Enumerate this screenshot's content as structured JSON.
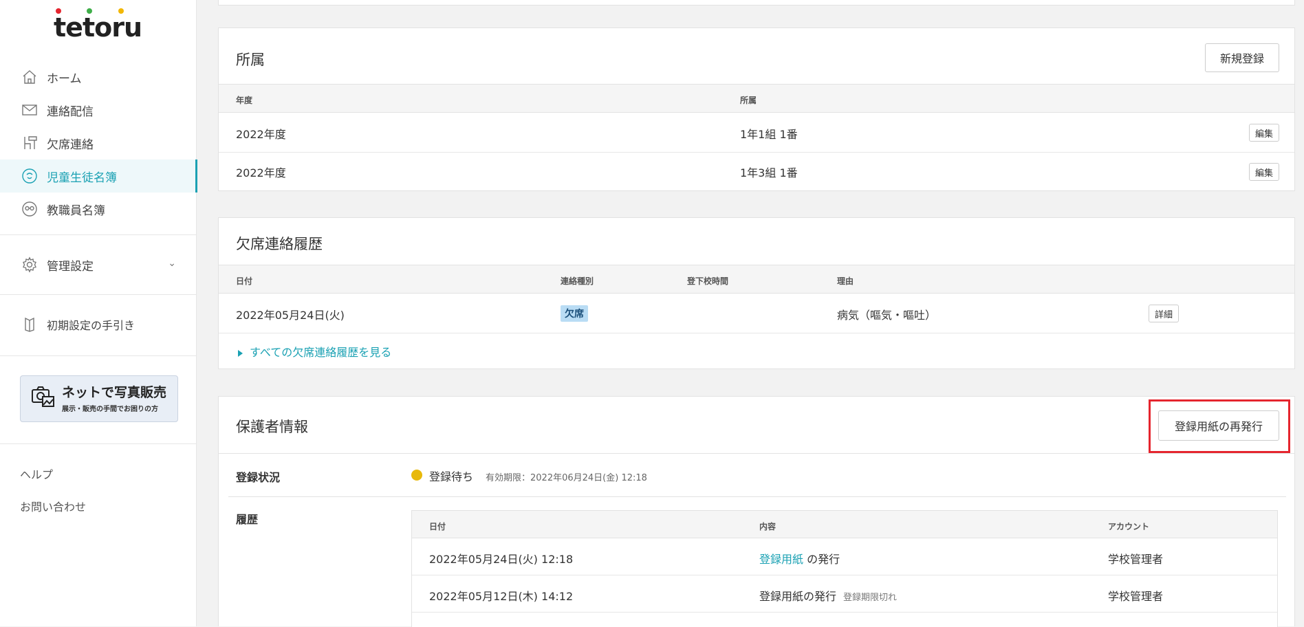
{
  "sidebar": {
    "logo_text": "tetoru",
    "logo_colors": [
      "#e5252e",
      "#3fae49",
      "#f2b705"
    ],
    "nav": [
      {
        "icon": "home-icon",
        "label": "ホーム"
      },
      {
        "icon": "mail-icon",
        "label": "連絡配信"
      },
      {
        "icon": "desk-chair-icon",
        "label": "欠席連絡"
      },
      {
        "icon": "student-icon",
        "label": "児童生徒名簿",
        "active": true
      },
      {
        "icon": "teacher-icon",
        "label": "教職員名簿"
      }
    ],
    "management": {
      "icon": "gear-icon",
      "label": "管理設定"
    },
    "guide": {
      "icon": "book-icon",
      "label": "初期設定の手引き"
    },
    "banner": {
      "icon": "camera-photo-icon",
      "main": "ネットで写真販売",
      "sub": "展示・販売の手間でお困りの方"
    },
    "help": "ヘルプ",
    "contact": "お問い合わせ"
  },
  "affiliation": {
    "title": "所属",
    "new_button": "新規登録",
    "headers": {
      "year": "年度",
      "affiliation": "所属"
    },
    "rows": [
      {
        "year": "2022年度",
        "affiliation": "1年1組 1番",
        "edit": "編集"
      },
      {
        "year": "2022年度",
        "affiliation": "1年3組 1番",
        "edit": "編集"
      }
    ]
  },
  "absence": {
    "title": "欠席連絡履歴",
    "headers": {
      "date": "日付",
      "type": "連絡種別",
      "time": "登下校時間",
      "reason": "理由"
    },
    "rows": [
      {
        "date": "2022年05月24日(火)",
        "type": "欠席",
        "time": "",
        "reason": "病気（嘔気・嘔吐）",
        "detail": "詳細"
      }
    ],
    "all_link": "すべての欠席連絡履歴を見る"
  },
  "guardian": {
    "title": "保護者情報",
    "reissue_button": "登録用紙の再発行",
    "status_label": "登録状況",
    "status_value": "登録待ち",
    "status_color": "#e8b90b",
    "expiry": "有効期限：2022年06月24日(金) 12:18",
    "history_label": "履歴",
    "history_headers": {
      "date": "日付",
      "content": "内容",
      "account": "アカウント"
    },
    "history": [
      {
        "date": "2022年05月24日(火) 12:18",
        "link": "登録用紙",
        "content": "の発行",
        "note": "",
        "account": "学校管理者"
      },
      {
        "date": "2022年05月12日(木) 14:12",
        "link": "",
        "content": "登録用紙の発行",
        "note": "登録期限切れ",
        "account": "学校管理者"
      }
    ]
  }
}
